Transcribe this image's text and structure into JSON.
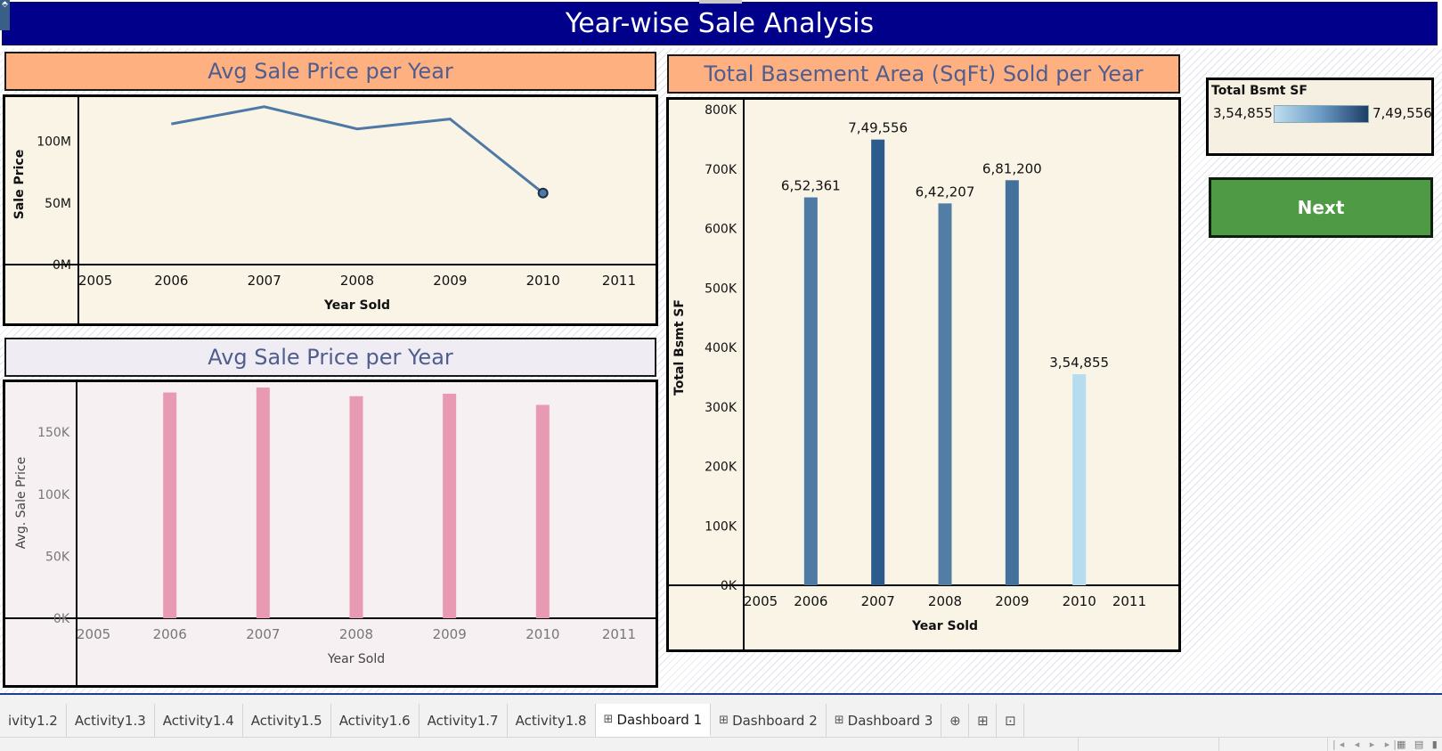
{
  "header": {
    "title": "Year-wise Sale Analysis",
    "control_glyph": "⬘"
  },
  "charts": [
    {
      "title": "Avg Sale Price per Year",
      "bg": "#faf4e6",
      "title_bg": "#ffb081"
    },
    {
      "title": "Avg Sale Price per Year",
      "bg": "#f6f0f3",
      "title_bg": "#f0ecf3"
    },
    {
      "title": "Total Basement Area (SqFt) Sold per Year",
      "bg": "#faf4e6",
      "title_bg": "#ffb081"
    }
  ],
  "chart_data": [
    {
      "type": "line",
      "title": "Avg Sale Price per Year",
      "xlabel": "Year Sold",
      "ylabel": "Sale Price",
      "x_ticks": [
        "2005",
        "2006",
        "2007",
        "2008",
        "2009",
        "2010",
        "2011"
      ],
      "y_ticks": [
        "0M",
        "50M",
        "100M"
      ],
      "xlim": [
        2005,
        2011
      ],
      "ylim": [
        0,
        130000000
      ],
      "series": [
        {
          "x": [
            2006,
            2007,
            2008,
            2009,
            2010
          ],
          "values": [
            114000000,
            128000000,
            110000000,
            118000000,
            58000000
          ],
          "color": "#4e79a7"
        }
      ],
      "grid": false
    },
    {
      "type": "bar",
      "title": "Avg Sale Price per Year",
      "xlabel": "Year Sold",
      "ylabel": "Avg. Sale Price",
      "x_ticks": [
        "2005",
        "2006",
        "2007",
        "2008",
        "2009",
        "2010",
        "2011"
      ],
      "y_ticks": [
        "0K",
        "50K",
        "100K",
        "150K"
      ],
      "xlim": [
        2005,
        2011
      ],
      "ylim": [
        0,
        186000
      ],
      "categories": [
        2006,
        2007,
        2008,
        2009,
        2010
      ],
      "values": [
        182000,
        186000,
        179000,
        181000,
        172000
      ],
      "color": "#e99ab3",
      "grid": false
    },
    {
      "type": "bar",
      "title": "Total Basement Area (SqFt) Sold per Year",
      "xlabel": "Year Sold",
      "ylabel": "Total Bsmt SF",
      "x_ticks": [
        "2005",
        "2006",
        "2007",
        "2008",
        "2009",
        "2010",
        "2011"
      ],
      "y_ticks": [
        "0K",
        "100K",
        "200K",
        "300K",
        "400K",
        "500K",
        "600K",
        "700K",
        "800K"
      ],
      "xlim": [
        2005,
        2011
      ],
      "ylim": [
        0,
        800000
      ],
      "categories": [
        2006,
        2007,
        2008,
        2009,
        2010
      ],
      "values": [
        652361,
        749556,
        642207,
        681200,
        354855
      ],
      "data_labels": [
        "6,52,361",
        "7,49,556",
        "6,42,207",
        "6,81,200",
        "3,54,855"
      ],
      "color_scale": {
        "min_color": "#b6dcef",
        "max_color": "#2c5a8a",
        "min": 354855,
        "max": 749556
      },
      "grid": false
    }
  ],
  "legend": {
    "title": "Total Bsmt SF",
    "min_label": "3,54,855",
    "max_label": "7,49,556"
  },
  "next_button": {
    "label": "Next"
  },
  "tabs": [
    {
      "label": "ivity1.2",
      "icon": "",
      "active": false
    },
    {
      "label": "Activity1.3",
      "icon": "",
      "active": false
    },
    {
      "label": "Activity1.4",
      "icon": "",
      "active": false
    },
    {
      "label": "Activity1.5",
      "icon": "",
      "active": false
    },
    {
      "label": "Activity1.6",
      "icon": "",
      "active": false
    },
    {
      "label": "Activity1.7",
      "icon": "",
      "active": false
    },
    {
      "label": "Activity1.8",
      "icon": "",
      "active": false
    },
    {
      "label": "Dashboard 1",
      "icon": "⊞",
      "active": true
    },
    {
      "label": "Dashboard 2",
      "icon": "⊞",
      "active": false
    },
    {
      "label": "Dashboard 3",
      "icon": "⊞",
      "active": false
    }
  ],
  "tab_tools": [
    {
      "name": "new-worksheet-icon",
      "glyph": "⊕"
    },
    {
      "name": "new-dashboard-icon",
      "glyph": "⊞"
    },
    {
      "name": "new-story-icon",
      "glyph": "⊡"
    }
  ],
  "pager_glyphs": "|◂ ◂ ▸ ▸|",
  "view_glyphs": "▦ ▤ ▮"
}
